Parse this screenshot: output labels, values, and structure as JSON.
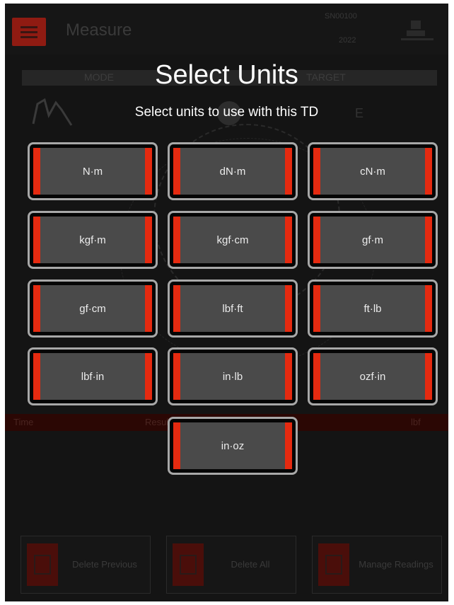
{
  "background_app": {
    "title": "Measure",
    "serial_line1": "SN00100",
    "serial_line2": "2022",
    "mode_label": "MODE",
    "target_label": "TARGET",
    "table_headers": {
      "time": "Time",
      "result": "Result",
      "third": "lbf"
    },
    "bottom_buttons": [
      {
        "label": "Delete Previous",
        "icon": "trash-icon"
      },
      {
        "label": "Delete All",
        "icon": "trash-icon"
      },
      {
        "label": "Manage Readings",
        "icon": "document-icon"
      }
    ]
  },
  "modal": {
    "title": "Select Units",
    "subtitle": "Select units to use with this TD",
    "units": [
      "N·m",
      "dN·m",
      "cN·m",
      "kgf·m",
      "kgf·cm",
      "gf·m",
      "gf·cm",
      "lbf·ft",
      "ft·lb",
      "lbf·in",
      "in·lb",
      "ozf·in",
      "in·oz"
    ]
  },
  "colors": {
    "accent_red": "#e52a10",
    "button_fill": "#4a4a4a",
    "button_border": "#a8a8a8",
    "background": "#141414"
  }
}
